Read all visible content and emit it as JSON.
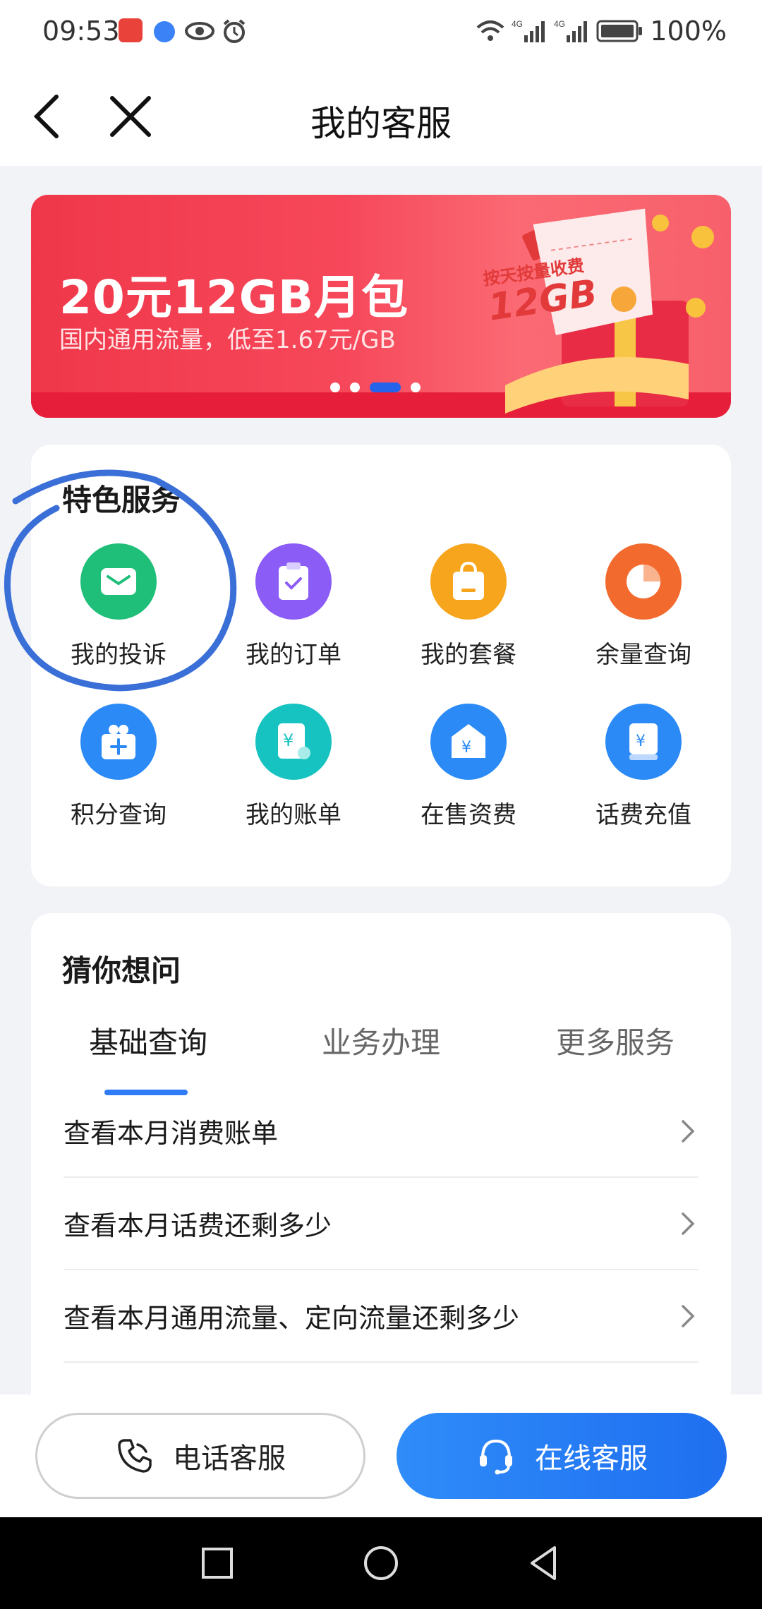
{
  "status_bar": {
    "time": "09:53",
    "battery": "100%",
    "network1": "4G",
    "network2": "4G"
  },
  "header": {
    "title": "我的客服"
  },
  "banner": {
    "title": "20元12GB月包",
    "subtitle": "国内通用流量，低至1.67元/GB",
    "badge_top": "按天按量收费",
    "badge_main": "12GB",
    "active_slide": 3,
    "slide_count": 4
  },
  "services": {
    "title": "特色服务",
    "items": [
      {
        "label": "我的投诉",
        "icon": "mail-icon",
        "color": "#1fbf7a"
      },
      {
        "label": "我的订单",
        "icon": "clipboard-check-icon",
        "color": "#8b5cf6"
      },
      {
        "label": "我的套餐",
        "icon": "bag-icon",
        "color": "#f7a51c"
      },
      {
        "label": "余量查询",
        "icon": "pie-chart-icon",
        "color": "#f26a2e"
      },
      {
        "label": "积分查询",
        "icon": "gift-plus-icon",
        "color": "#2b8af6"
      },
      {
        "label": "我的账单",
        "icon": "bill-icon",
        "color": "#17c3c0"
      },
      {
        "label": "在售资费",
        "icon": "price-tag-icon",
        "color": "#2b8af6"
      },
      {
        "label": "话费充值",
        "icon": "recharge-icon",
        "color": "#2b8af6"
      }
    ]
  },
  "faq": {
    "title": "猜你想问",
    "tabs": [
      "基础查询",
      "业务办理",
      "更多服务"
    ],
    "active_tab": 0,
    "items": [
      "查看本月消费账单",
      "查看本月话费还剩多少",
      "查看本月通用流量、定向流量还剩多少"
    ]
  },
  "actions": {
    "phone_label": "电话客服",
    "online_label": "在线客服"
  },
  "colors": {
    "primary": "#2f7cf6",
    "banner": "#f0374a",
    "annotation": "#3a6fd8"
  }
}
